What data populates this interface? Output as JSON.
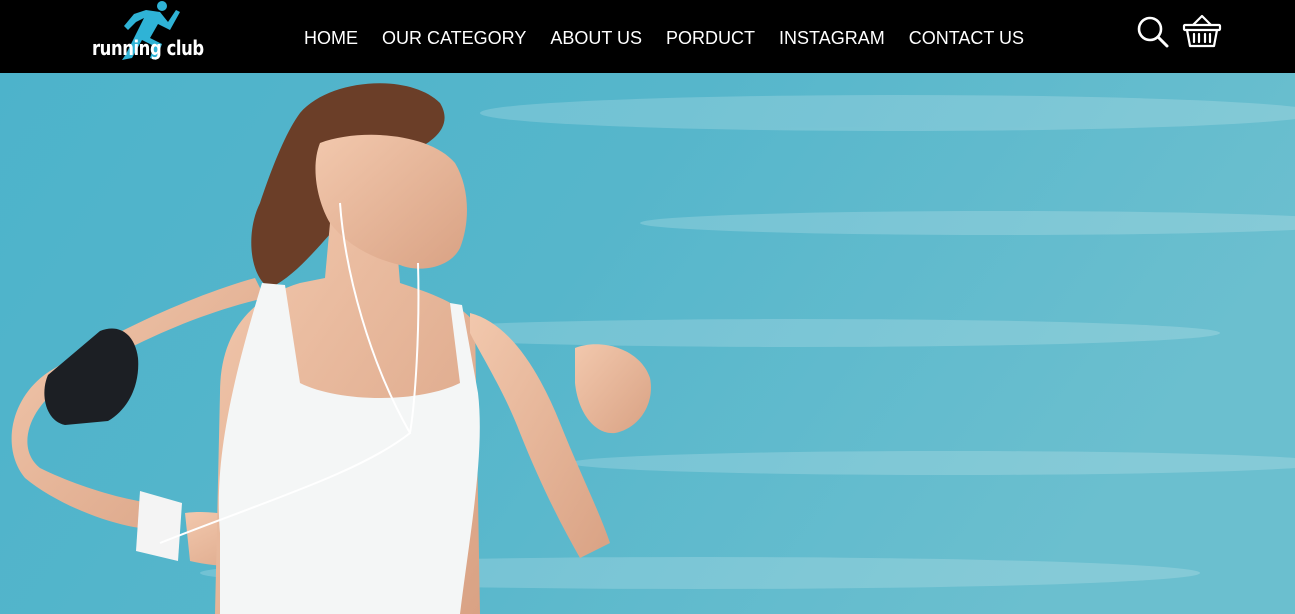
{
  "header": {
    "logo": {
      "text": "running club",
      "icon": "runner-icon",
      "accent": "#2fb3d6"
    },
    "nav": [
      {
        "label": "HOME"
      },
      {
        "label": "OUR CATEGORY"
      },
      {
        "label": "ABOUT US"
      },
      {
        "label": "PORDUCT"
      },
      {
        "label": "INSTAGRAM"
      },
      {
        "label": "CONTACT US"
      }
    ],
    "tools": [
      {
        "icon": "search-icon"
      },
      {
        "icon": "basket-icon"
      }
    ]
  },
  "hero": {
    "image": "woman-running-by-sea-photo",
    "colors": {
      "background": "#5ab8cd",
      "header": "#000000"
    }
  }
}
